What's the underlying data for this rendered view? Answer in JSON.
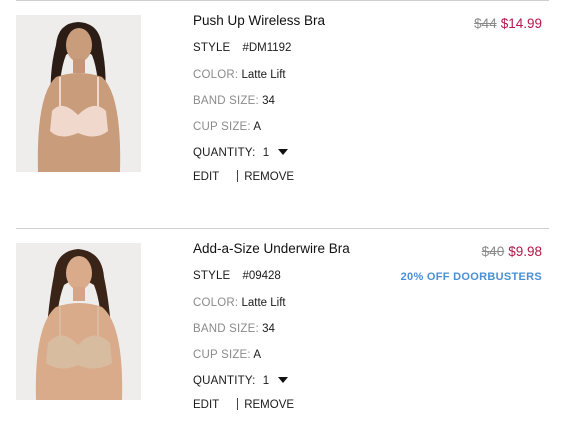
{
  "labels": {
    "style": "STYLE",
    "color": "COLOR:",
    "band_size": "BAND SIZE:",
    "cup_size": "CUP SIZE:",
    "quantity": "QUANTITY:",
    "edit": "EDIT",
    "remove": "REMOVE"
  },
  "items": [
    {
      "name": "Push Up Wireless Bra",
      "style": "#DM1192",
      "color": "Latte Lift",
      "band_size": "34",
      "cup_size": "A",
      "quantity": "1",
      "original_price": "$44",
      "sale_price": "$14.99",
      "badge": ""
    },
    {
      "name": "Add-a-Size Underwire Bra",
      "style": "#09428",
      "color": "Latte Lift",
      "band_size": "34",
      "cup_size": "A",
      "quantity": "1",
      "original_price": "$40",
      "sale_price": "$9.98",
      "badge": "20% OFF DOORBUSTERS"
    }
  ],
  "colors": {
    "sale_price": "#b3184a",
    "badge": "#4a8fd6",
    "muted_label": "#8a8a8a",
    "divider": "#cfcfcf"
  },
  "icons": [
    "product-photo",
    "chevron-down-icon"
  ]
}
